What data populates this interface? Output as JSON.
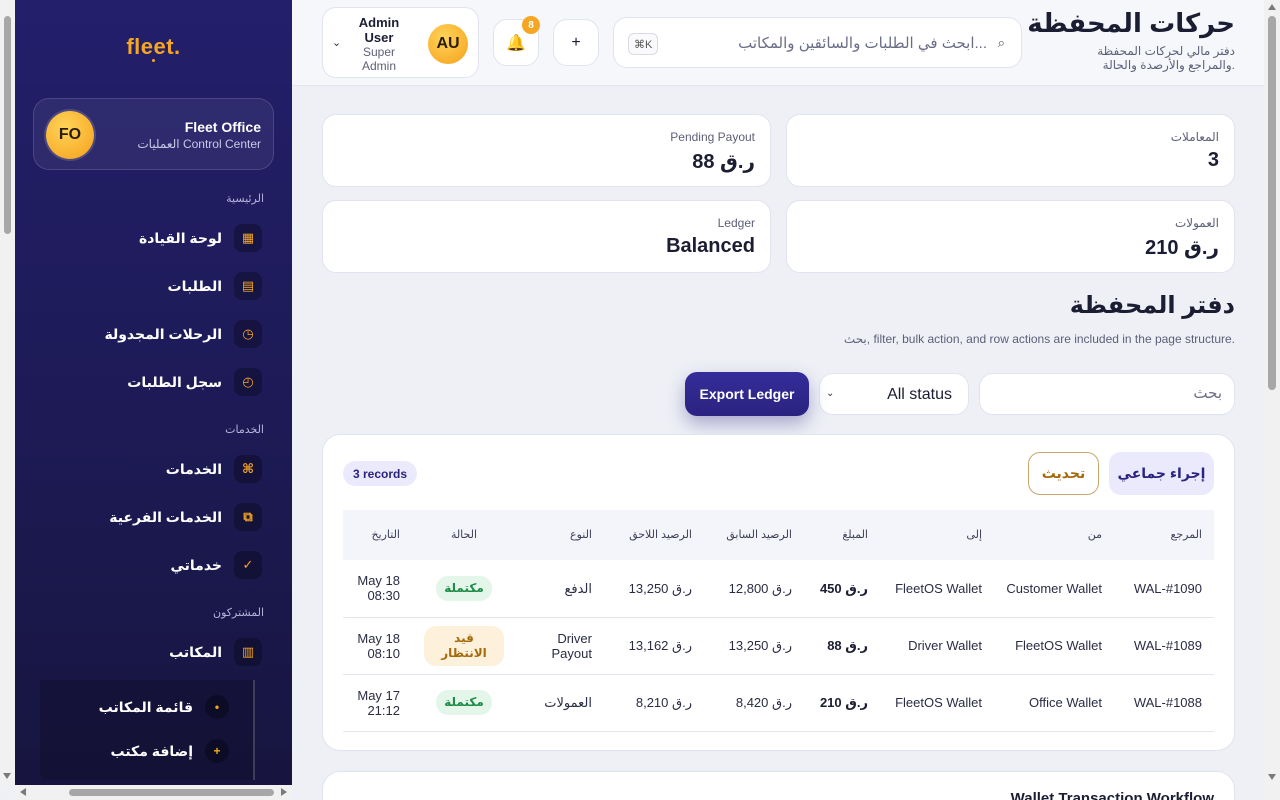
{
  "sidebar": {
    "logo": "fleet.",
    "office": {
      "initials": "FO",
      "name": "Fleet Office",
      "subtitle": "العمليات Control Center"
    },
    "sections": {
      "main": "الرئيسية",
      "services": "الخدمات",
      "subscribers": "المشتركون"
    },
    "items": [
      {
        "label": "لوحة القيادة",
        "icon": "dashboard-icon",
        "glyph": "▦"
      },
      {
        "label": "الطلبات",
        "icon": "orders-icon",
        "glyph": "▤"
      },
      {
        "label": "الرحلات المجدولة",
        "icon": "clock-icon",
        "glyph": "◷"
      },
      {
        "label": "سجل الطلبات",
        "icon": "history-icon",
        "glyph": "◴"
      },
      {
        "label": "الخدمات",
        "icon": "command-icon",
        "glyph": "⌘"
      },
      {
        "label": "الخدمات الفرعية",
        "icon": "copy-icon",
        "glyph": "⧉"
      },
      {
        "label": "خدماتي",
        "icon": "check-icon",
        "glyph": "✓"
      },
      {
        "label": "المكاتب",
        "icon": "building-icon",
        "glyph": "▥"
      }
    ],
    "subitems": [
      {
        "label": "قائمة المكاتب",
        "glyph": "•"
      },
      {
        "label": "إضافة مكتب",
        "glyph": "+"
      }
    ]
  },
  "header": {
    "title": "حركات المحفظة",
    "description": "دفتر مالي لحركات المحفظة والمراجع والأرصدة والحالة.",
    "search_placeholder": "ابحث في الطلبات والسائقين والمكاتب...",
    "search_glyph": "⌕",
    "kbd": "⌘K",
    "add_glyph": "+",
    "bell_glyph": "🔔",
    "notifications": "8",
    "user": {
      "initials": "AU",
      "name": "Admin User",
      "role": "Super Admin"
    }
  },
  "stats": [
    {
      "label": "المعاملات",
      "value": "3"
    },
    {
      "label": "Pending Payout",
      "value": "ر.ق 88"
    },
    {
      "label": "العمولات",
      "value": "ر.ق 210"
    },
    {
      "label": "Ledger",
      "value": "Balanced"
    }
  ],
  "ledger": {
    "title": "دفتر المحفظة",
    "description": "بحث, filter, bulk action, and row actions are included in the page structure.",
    "search_placeholder": "بحث",
    "status_value": "All status",
    "export_label": "Export Ledger",
    "bulk_label": "إجراء جماعي",
    "refresh_label": "تحديث",
    "records": "3 records",
    "columns": [
      "المرجع",
      "من",
      "إلى",
      "المبلغ",
      "الرصيد السابق",
      "الرصيد اللاحق",
      "النوع",
      "الحالة",
      "التاريخ"
    ],
    "rows": [
      {
        "ref": "WAL-#1090",
        "from": "Customer Wallet",
        "to": "FleetOS Wallet",
        "amount": "ر.ق 450",
        "before": "ر.ق 12,800",
        "after": "ر.ق 13,250",
        "type": "الدفع",
        "status": "مكتملة",
        "status_kind": "ok",
        "date": "May 18 08:30"
      },
      {
        "ref": "WAL-#1089",
        "from": "FleetOS Wallet",
        "to": "Driver Wallet",
        "amount": "ر.ق 88",
        "before": "ر.ق 13,250",
        "after": "ر.ق 13,162",
        "type": "Driver Payout",
        "status": "قيد الانتظار",
        "status_kind": "wait",
        "date": "May 18 08:10"
      },
      {
        "ref": "WAL-#1088",
        "from": "Office Wallet",
        "to": "FleetOS Wallet",
        "amount": "ر.ق 210",
        "before": "ر.ق 8,420",
        "after": "ر.ق 8,210",
        "type": "العمولات",
        "status": "مكتملة",
        "status_kind": "ok",
        "date": "May 17 21:12"
      }
    ]
  },
  "workflow": {
    "title": "Wallet Transaction Workflow"
  }
}
